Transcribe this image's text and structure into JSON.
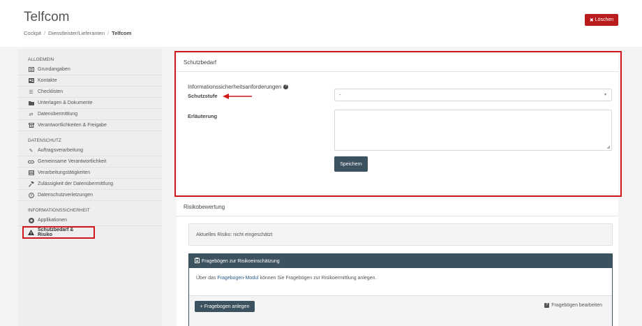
{
  "header": {
    "title": "Telfcom",
    "breadcrumb": [
      "Cockpit",
      "Dienstleister/Lieferanten",
      "Telfcom"
    ],
    "delete_label": "Löschen"
  },
  "sidebar": {
    "sections": [
      {
        "heading": "ALLGEMEIN",
        "items": [
          {
            "label": "Grundangaben",
            "icon": "list-card-icon"
          },
          {
            "label": "Kontakte",
            "icon": "id-card-icon"
          },
          {
            "label": "Checklisten",
            "icon": "checklist-icon"
          },
          {
            "label": "Unterlagen & Dokumente",
            "icon": "folder-icon"
          },
          {
            "label": "Datenübermittlung",
            "icon": "exchange-icon"
          },
          {
            "label": "Verantwortlichkeiten & Freigabe",
            "icon": "sitemap-icon"
          }
        ]
      },
      {
        "heading": "DATENSCHUTZ",
        "items": [
          {
            "label": "Auftragsverarbeitung",
            "icon": "edit-icon"
          },
          {
            "label": "Gemeinsame Verantwortlichkeit",
            "icon": "handshake-icon"
          },
          {
            "label": "Verarbeitungstätigkeiten",
            "icon": "table-icon"
          },
          {
            "label": "Zulässigkeit der Datenübermittlung",
            "icon": "gavel-icon"
          },
          {
            "label": "Datenschutzverletzungen",
            "icon": "alert-circle-icon"
          }
        ]
      },
      {
        "heading": "INFORMATIONSSICHERHEIT",
        "items": [
          {
            "label": "Applikationen",
            "icon": "plus-circle-icon"
          },
          {
            "label": "Schutzbedarf & Risiko",
            "icon": "warning-icon"
          }
        ]
      }
    ]
  },
  "schutzbedarf": {
    "header": "Schutzbedarf",
    "section_title": "Informationssicherheitsanforderungen",
    "schutzstufe_label": "Schutzstufe",
    "schutzstufe_value": "-",
    "erlaeuterung_label": "Erläuterung",
    "save_label": "Speichern"
  },
  "risiko": {
    "header": "Risikobewertung",
    "current_risk": "Aktuelles Risiko: nicht eingeschätzt",
    "panel_title": "Fragebögen zur Risikoeinschätzung",
    "body_prefix": "Über das",
    "body_link": "Fragebogen-Modul",
    "body_suffix": "können Sie Fragebögen zur Risikoermittlung anlegen.",
    "add_label": "Fragebogen anlegen",
    "edit_label": "Fragebögen bearbeiten"
  },
  "colors": {
    "accent_red": "#b81c1c",
    "highlight_red": "#d0181c",
    "dark_slate": "#3d525f"
  }
}
